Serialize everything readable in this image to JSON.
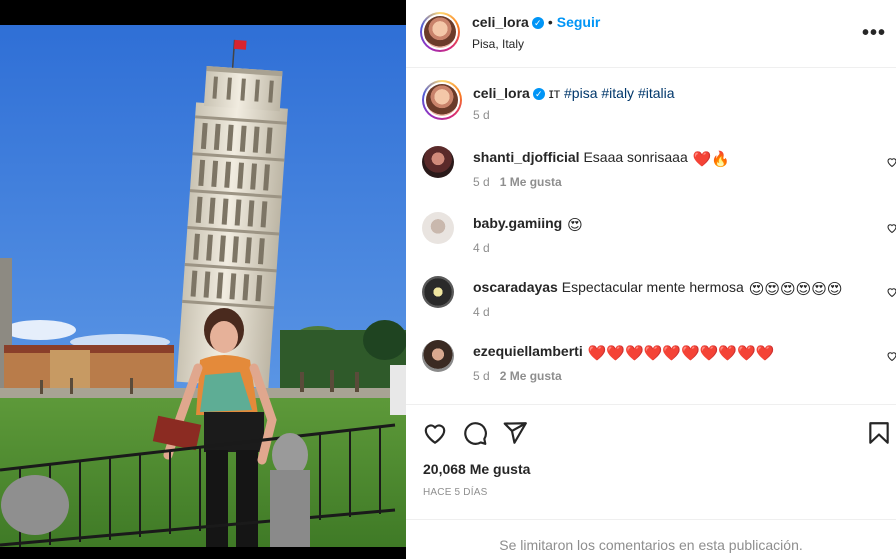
{
  "post": {
    "username": "celi_lora",
    "follow_label": "Seguir",
    "location": "Pisa, Italy",
    "caption_prefix": "ɪᴛ",
    "caption_tags": [
      "#pisa",
      "#italy",
      "#italia"
    ],
    "caption_time": "5 d",
    "likes_label": "20,068 Me gusta",
    "time_ago": "HACE 5 DÍAS",
    "comments_closed": "Se limitaron los comentarios en esta publicación."
  },
  "comments": [
    {
      "user": "shanti_djofficial",
      "text": "Esaaa sonrisaaa",
      "emojis": "❤️🔥",
      "time": "5 d",
      "likes": "1 Me gusta"
    },
    {
      "user": "baby.gamiing",
      "text": "",
      "emojis": "😍",
      "time": "4 d",
      "likes": ""
    },
    {
      "user": "oscaradayas",
      "text": "Espectacular mente hermosa",
      "emojis": "😍😍😍😍😍😍",
      "time": "4 d",
      "likes": ""
    },
    {
      "user": "ezequiellamberti",
      "text": "",
      "emojis": "❤️❤️❤️❤️❤️❤️❤️❤️❤️❤️",
      "time": "5 d",
      "likes": "2 Me gusta"
    }
  ],
  "icons": {
    "more": "more-options-icon",
    "verified": "verified-badge-icon",
    "like": "heart-icon",
    "comment": "comment-icon",
    "share": "share-icon",
    "save": "bookmark-icon"
  },
  "colors": {
    "accent": "#0095f6",
    "muted": "#8e8e8e",
    "hashtag": "#00376b"
  }
}
